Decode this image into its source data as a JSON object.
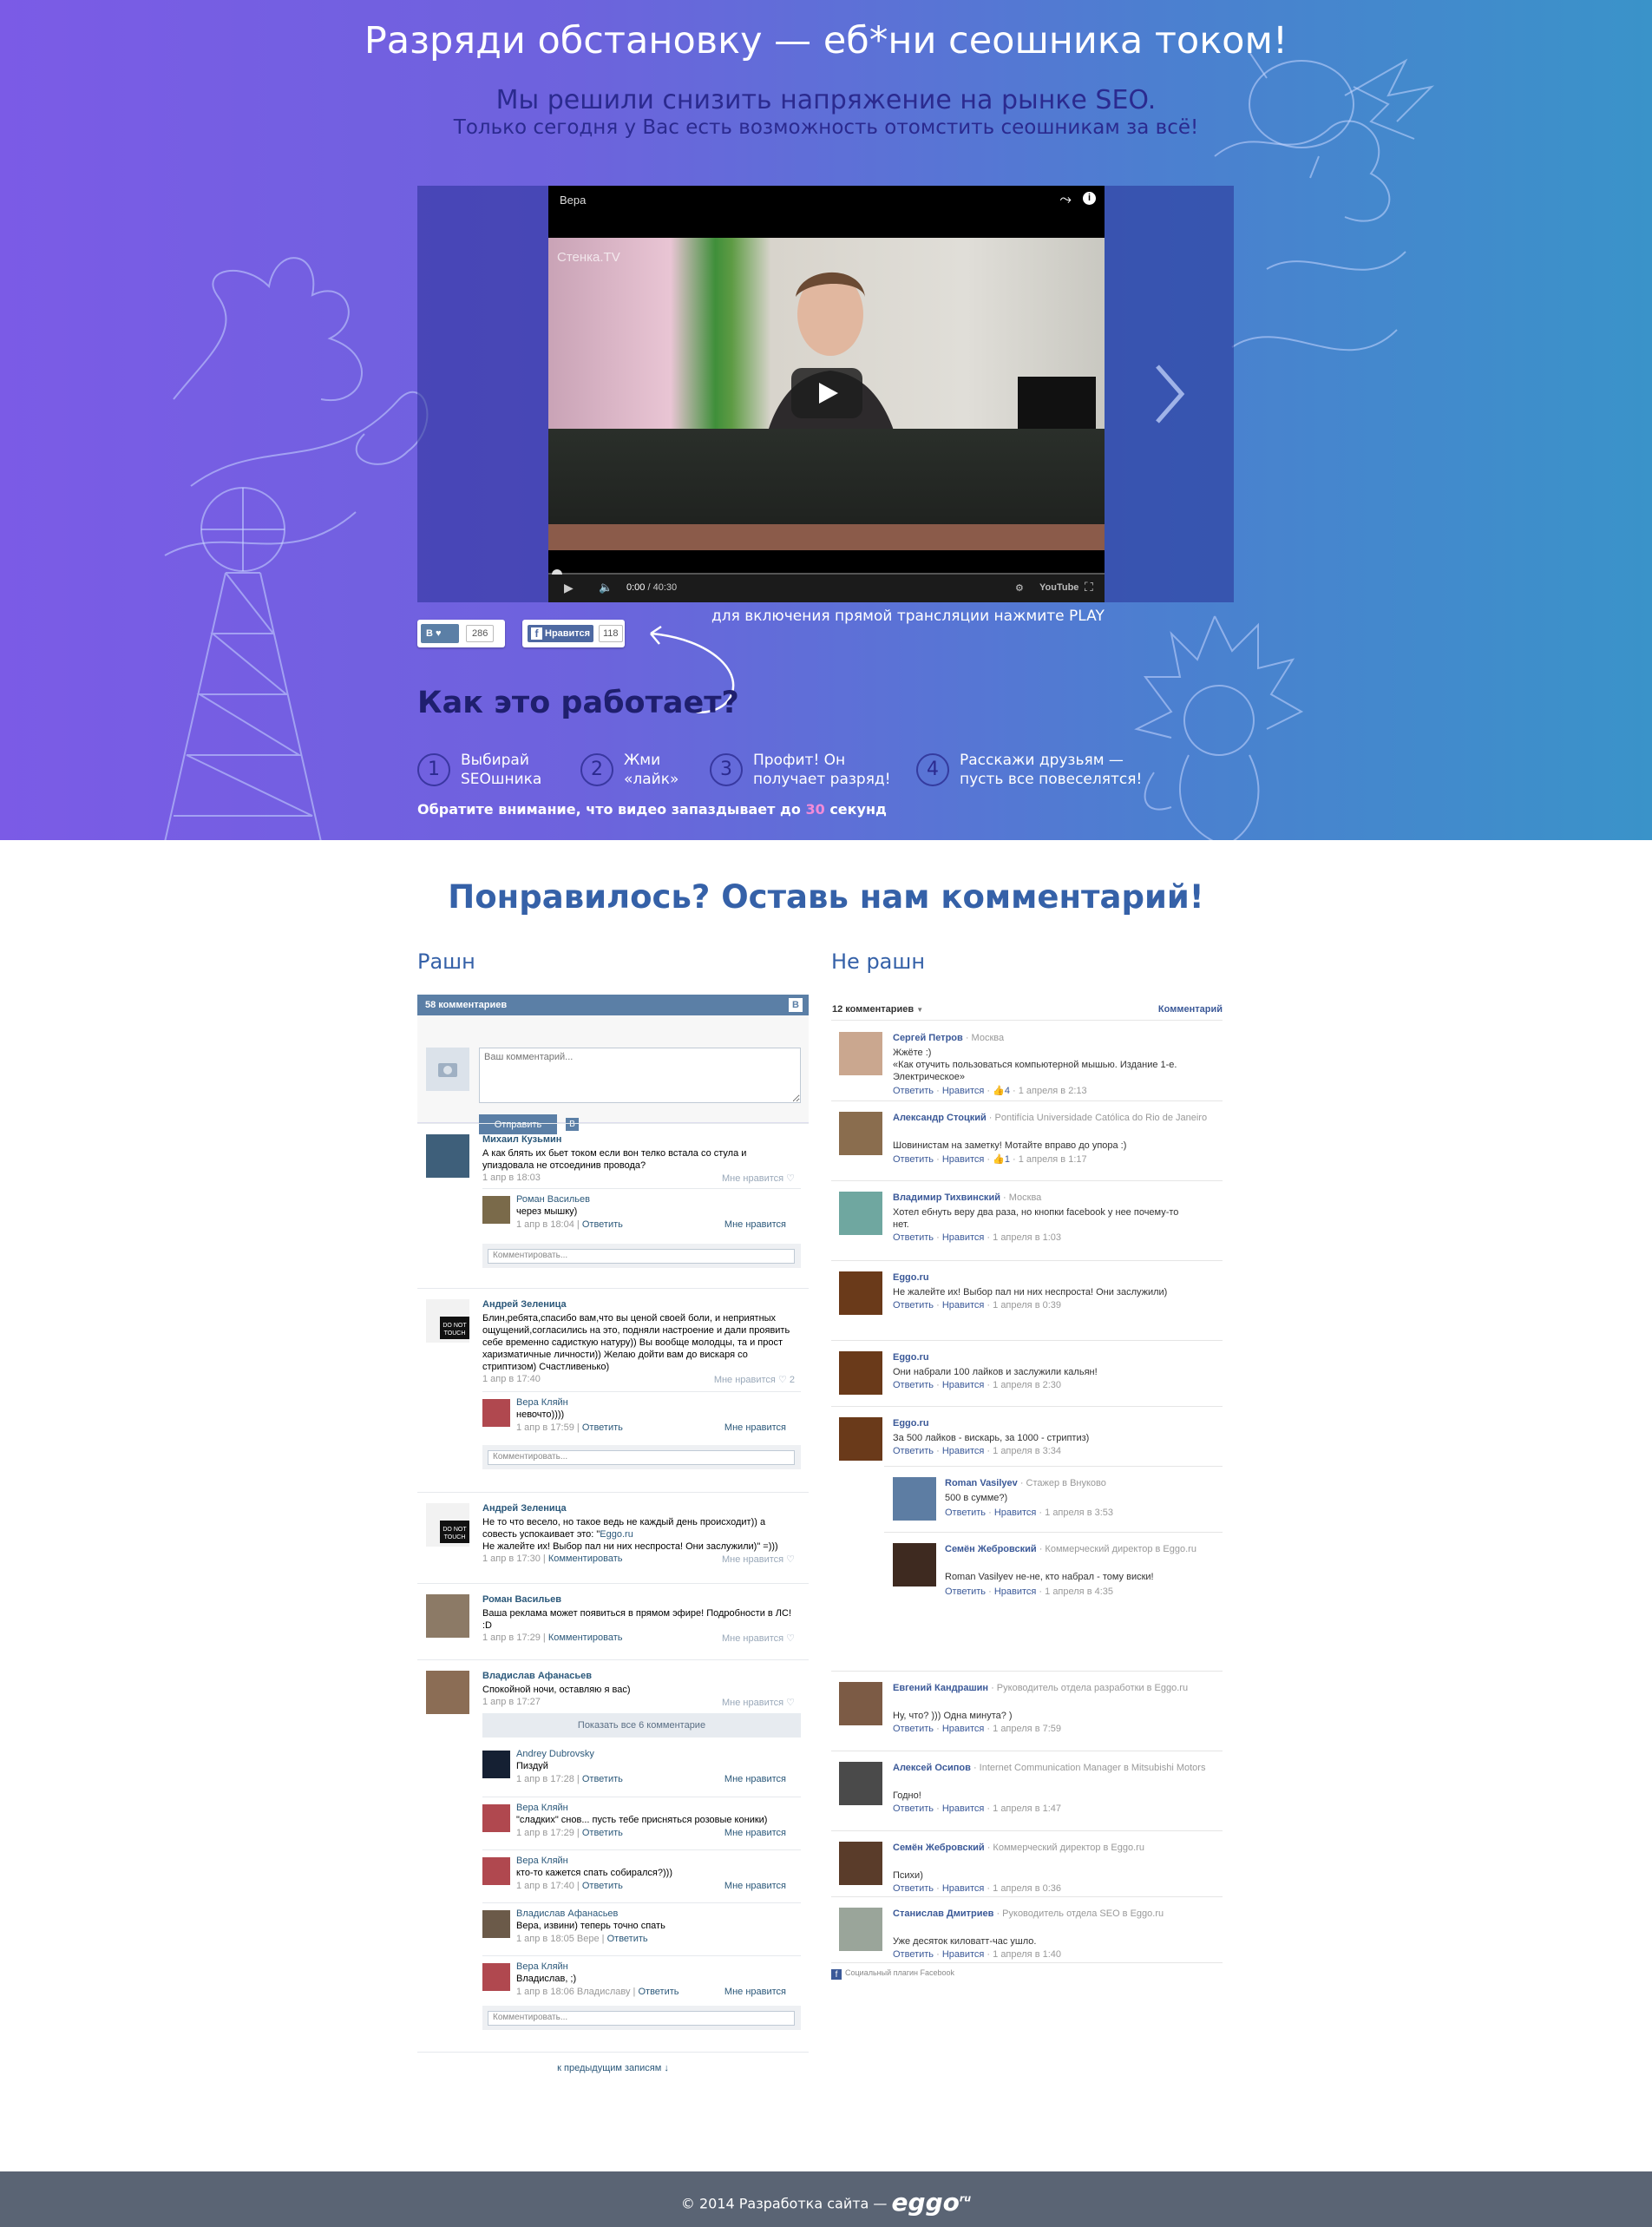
{
  "hero": {
    "title": "Разряди обстановку — еб*ни сеошника током!",
    "subtitle": "Мы решили снизить напряжение на рынке SEO.",
    "subtitle2": "Только сегодня у Вас есть возможность отомстить сеошникам за всё!",
    "video": {
      "title": "Вера",
      "time": "0:00",
      "duration": "40:30",
      "brand": "YouTube",
      "watermark": "Стенка.TV",
      "progress": 0
    },
    "share_vk": {
      "label": "В",
      "count": "286"
    },
    "share_fb": {
      "label": "Нравится",
      "count": "118"
    },
    "play_hint": "для включения прямой трансляции нажмите PLAY",
    "how_title": "Как это работает?",
    "steps": [
      {
        "num": "1",
        "line1": "Выбирай",
        "line2": "SEOшника"
      },
      {
        "num": "2",
        "line1": "Жми",
        "line2": "«лайк»"
      },
      {
        "num": "3",
        "line1": "Профит! Он",
        "line2": "получает разряд!"
      },
      {
        "num": "4",
        "line1": "Расскажи друзьям —",
        "line2": "пусть все повеселятся!"
      }
    ],
    "note_before": "Обратите внимание, что видео запаздывает до",
    "note_value": "30",
    "note_after": "секунд"
  },
  "comments": {
    "title": "Понравилось? Оставь нам комментарий!",
    "col_left": "Рашн",
    "col_right": "Не рашн"
  },
  "vk": {
    "count": "58 комментариев",
    "logo": "В",
    "placeholder": "Ваш комментарий...",
    "send": "Отправить",
    "reply_placeholder": "Комментировать...",
    "show_all": "Показать все 6 комментарие",
    "prev": "к предыдущим записям ↓",
    "posts": [
      {
        "name": "Михаил Кузьмин",
        "text": "А как блять их бьет током если вон телко встала со стула и упиздовала не отсоединив провода?",
        "date": "1 апр в 18:03",
        "like": "Мне нравится ♡",
        "replies": [
          {
            "name": "Роман Васильев",
            "text": "через мышку)",
            "date": "1 апр в 18:04",
            "reply": "Ответить",
            "like": "Мне нравится"
          }
        ]
      },
      {
        "name": "Андрей Зеленица",
        "text": "Блин,ребята,спасибо вам,что вы ценой своей боли, и неприятных ощущений,согласились на это, подняли настроение и дали проявить себе временно садисткую натуру)) Вы вообще молодцы, та и прост харизматичные личности)) Желаю дойти вам до вискаря со стриптизом) Счастливенько)",
        "date": "1 апр в 17:40",
        "like": "Мне нравится ♡ 2",
        "replies": [
          {
            "name": "Вера Кляйн",
            "text": "невочто))))",
            "date": "1 апр в 17:59",
            "reply": "Ответить",
            "like": "Мне нравится"
          }
        ]
      },
      {
        "name": "Андрей Зеленица",
        "text1": "Не то что весело, но такое ведь не каждый день происходит)) а совесть успокаивает это: \"",
        "link": "Eggo.ru",
        "text2": "Не жалейте их! Выбор пал ни них неспроста! Они заслужили)\" =)))",
        "date": "1 апр в 17:30",
        "comment": "Комментировать",
        "like": "Мне нравится ♡"
      },
      {
        "name": "Роман Васильев",
        "text": "Ваша реклама может появиться в прямом эфире! Подробности в ЛС! :D",
        "date": "1 апр в 17:29",
        "comment": "Комментировать",
        "like": "Мне нравится ♡"
      },
      {
        "name": "Владислав Афанасьев",
        "text": "Спокойной ночи, оставляю я вас)",
        "date": "1 апр в 17:27",
        "like": "Мне нравится ♡",
        "replies": [
          {
            "name": "Andrey Dubrovsky",
            "text": "Пиздуй",
            "date": "1 апр в 17:28",
            "reply": "Ответить",
            "like": "Мне нравится"
          },
          {
            "name": "Вера Кляйн",
            "text": "\"сладких\" снов... пусть тебе присняться розовые коники)",
            "date": "1 апр в 17:29",
            "reply": "Ответить",
            "like": "Мне нравится"
          },
          {
            "name": "Вера Кляйн",
            "text": "кто-то кажется спать собирался?)))",
            "date": "1 апр в 17:40",
            "reply": "Ответить",
            "like": "Мне нравится"
          },
          {
            "name": "Владислав Афанасьев",
            "text": "Вера, извини) теперь точно спать",
            "date": "1 апр в 18:05 Вере",
            "reply": "Ответить",
            "like": ""
          },
          {
            "name": "Вера Кляйн",
            "text": "Владислав, ;)",
            "date": "1 апр в 18:06 Владиславу",
            "reply": "Ответить",
            "like": "Мне нравится"
          }
        ]
      }
    ]
  },
  "fb": {
    "count": "12 комментариев",
    "sort": "Комментарий",
    "plugin": "Социальный плагин Facebook",
    "reply": "Ответить",
    "like": "Нравится",
    "items": [
      {
        "name": "Сергей Петров",
        "sub": " · Москва",
        "text": "Жжёте :)\n«Как отучить пользоваться компьютерной мышью. Издание 1-е. Электрическое»",
        "likes": "4",
        "date": "1 апреля в 2:13"
      },
      {
        "name": "Александр Стоцкий",
        "sub": " · Pontifícia Universidade Católica do Rio de Janeiro",
        "text": "Шовинистам на заметку! Мотайте вправо до упора :)",
        "likes": "1",
        "date": "1 апреля в 1:17"
      },
      {
        "name": "Владимир Тихвинский",
        "sub": " · Москва",
        "text": "Хотел ебнуть веру два раза, но кнопки facebook у нее почему-то нет.",
        "likes": "",
        "date": "1 апреля в 1:03"
      },
      {
        "name": "Eggo.ru",
        "sub": "",
        "text": "Не жалейте их! Выбор пал ни них неспроста! Они заслужили)",
        "likes": "",
        "date": "1 апреля в 0:39"
      },
      {
        "name": "Eggo.ru",
        "sub": "",
        "text": "Они набрали 100 лайков и заслужили кальян!",
        "likes": "",
        "date": "1 апреля в 2:30"
      },
      {
        "name": "Eggo.ru",
        "sub": "",
        "text": "За 500 лайков - вискарь, за 1000 - стриптиз)",
        "likes": "",
        "date": "1 апреля в 3:34",
        "replies": [
          {
            "name": "Roman Vasilyev",
            "sub": " · Стажер в Внуково",
            "text": "500 в сумме?)",
            "date": "1 апреля в 3:53"
          },
          {
            "name": "Семён Жебровский",
            "sub": " · Коммерческий директор в Eggo.ru",
            "text": "Roman Vasilyev не-не, кто набрал - тому виски!",
            "date": "1 апреля в 4:35"
          }
        ]
      },
      {
        "name": "Евгений Кандрашин",
        "sub": " · Руководитель отдела разработки в Eggo.ru",
        "text": "Ну, что? ))) Одна минута? )",
        "likes": "",
        "date": "1 апреля в 7:59"
      },
      {
        "name": "Алексей Осипов",
        "sub": " · Internet Communication Manager в Mitsubishi Motors",
        "text": "Годно!",
        "likes": "",
        "date": "1 апреля в 1:47"
      },
      {
        "name": "Семён Жебровский",
        "sub": " · Коммерческий директор в Eggo.ru",
        "text": "Психи)",
        "likes": "",
        "date": "1 апреля в 0:36"
      },
      {
        "name": "Станислав Дмитриев",
        "sub": " · Руководитель отдела SEO в Eggo.ru",
        "text": "Уже десяток киловатт-час ушло.",
        "likes": "",
        "date": "1 апреля в 1:40"
      }
    ]
  },
  "footer": {
    "text": "© 2014 Разработка сайта —",
    "brand": "eggo",
    "brand_sup": "ru"
  },
  "colors": {
    "hero_left": "#7b5be6",
    "hero_right": "#3a93c9",
    "accent": "#3561a8",
    "vk": "#5b7fa6",
    "fb": "#3b5998",
    "footer": "#5a6474"
  }
}
